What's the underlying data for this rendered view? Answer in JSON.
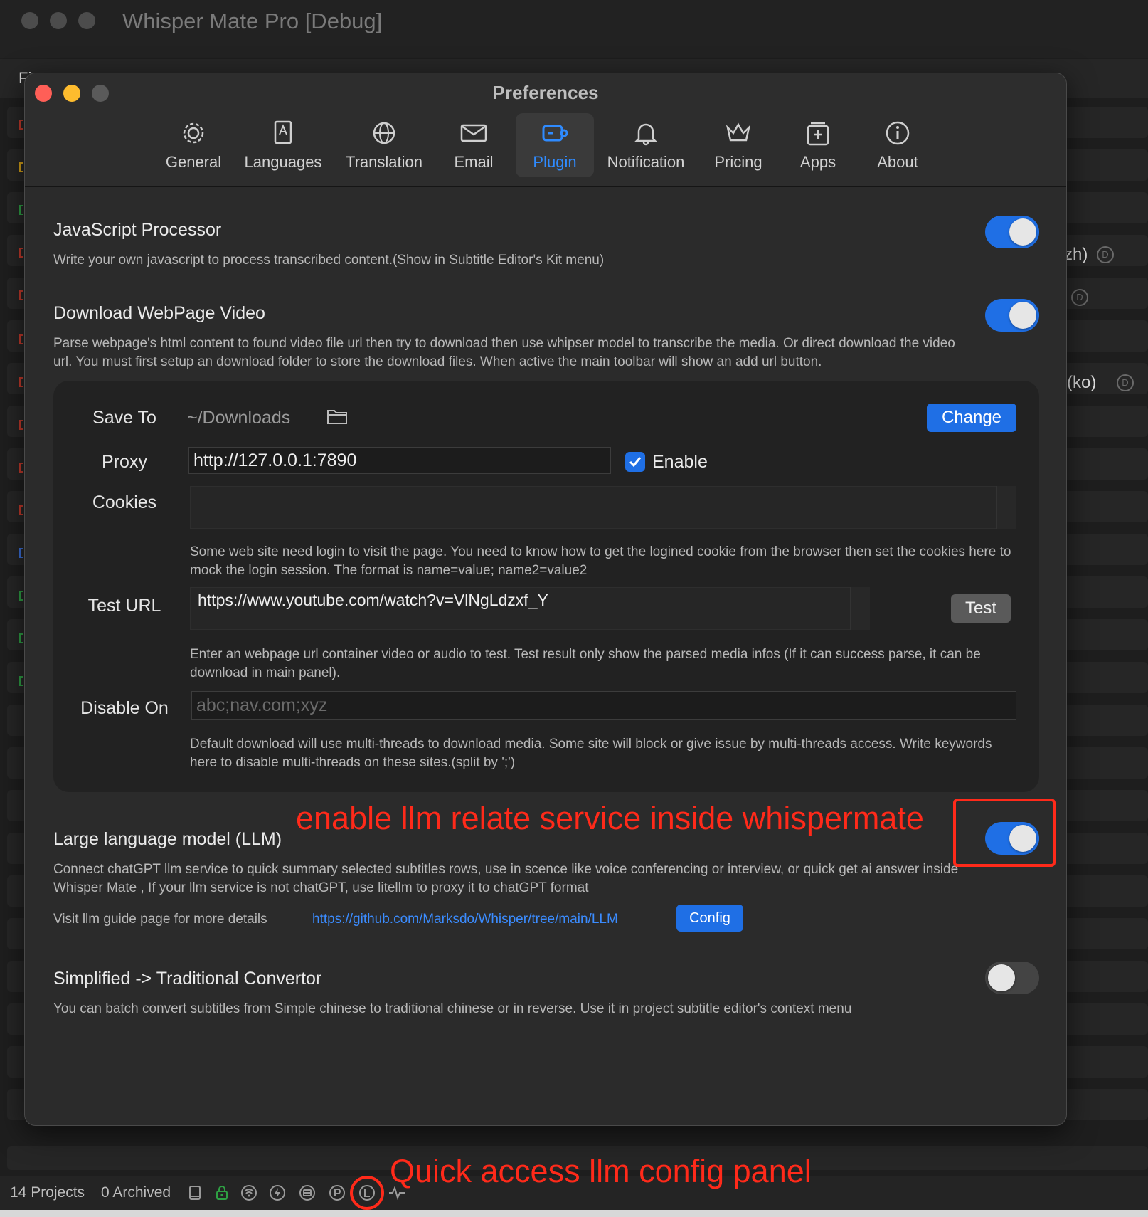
{
  "app": {
    "title": "Whisper Mate Pro [Debug]",
    "menu_first_letter": "Fi"
  },
  "background_list": {
    "visible_text_1": "zh)",
    "visible_text_2": "(ko)",
    "badge_letter": "D"
  },
  "preferences": {
    "title": "Preferences",
    "tabs": [
      {
        "label": "General",
        "icon": "gear-icon"
      },
      {
        "label": "Languages",
        "icon": "dictionary-icon"
      },
      {
        "label": "Translation",
        "icon": "globe-icon"
      },
      {
        "label": "Email",
        "icon": "envelope-icon"
      },
      {
        "label": "Plugin",
        "icon": "plugin-icon"
      },
      {
        "label": "Notification",
        "icon": "bell-icon"
      },
      {
        "label": "Pricing",
        "icon": "crown-icon"
      },
      {
        "label": "Apps",
        "icon": "apps-icon"
      },
      {
        "label": "About",
        "icon": "info-icon"
      }
    ],
    "active_tab": "Plugin"
  },
  "plugins": {
    "js_processor": {
      "title": "JavaScript Processor",
      "description": "Write your own javascript to process transcribed content.(Show in Subtitle Editor's Kit menu)",
      "enabled": true
    },
    "download_video": {
      "title": "Download WebPage Video",
      "description": "Parse webpage's html content to found video file url then try to download then use whipser model to transcribe the media. Or direct download the video url. You must first setup an download folder to store the download files. When active the main toolbar will show an add url button.",
      "enabled": true,
      "save_to_label": "Save To",
      "save_to_value": "~/Downloads",
      "change_button": "Change",
      "proxy_label": "Proxy",
      "proxy_value": "http://127.0.0.1:7890",
      "proxy_enable_label": "Enable",
      "proxy_enabled": true,
      "cookies_label": "Cookies",
      "cookies_value": "",
      "cookies_help": "Some web site need login to visit the page. You need to know how to get the logined cookie from the browser then set the cookies here to mock the login session. The format is name=value; name2=value2",
      "test_url_label": "Test URL",
      "test_url_value": "https://www.youtube.com/watch?v=VlNgLdzxf_Y",
      "test_button": "Test",
      "test_url_help": "Enter an webpage url container video or audio to test. Test result only show the parsed media infos (If it can success parse, it can be download in main panel).",
      "disable_on_label": "Disable On",
      "disable_on_placeholder": "abc;nav.com;xyz",
      "disable_on_help": "Default download will use multi-threads to download media. Some site will block or give issue by multi-threads access. Write keywords here to disable multi-threads on these sites.(split by ';')"
    },
    "llm": {
      "title": "Large language model (LLM)",
      "description": "Connect chatGPT llm service to quick summary selected subtitles rows, use in scence like voice conferencing or interview, or quick get ai answer inside Whisper Mate , If your llm service is not chatGPT, use litellm to proxy it to chatGPT format",
      "enabled": true,
      "guide_text": "Visit llm guide page for more details",
      "guide_link": "https://github.com/Marksdo/Whisper/tree/main/LLM",
      "config_button": "Config"
    },
    "convertor": {
      "title": "Simplified -> Traditional Convertor",
      "description": "You can batch convert subtitles from Simple chinese to traditional chinese or in reverse. Use it in project subtitle editor's context menu",
      "enabled": false
    }
  },
  "annotations": {
    "llm_toggle_note": "enable llm relate service inside whispermate",
    "status_note": "Quick access llm config panel"
  },
  "statusbar": {
    "projects": "14 Projects",
    "archived": "0 Archived",
    "icons": [
      "notebook-icon",
      "lock-icon",
      "wifi-icon",
      "bolt-icon",
      "storage-icon",
      "p-circle-icon",
      "llm-icon",
      "waveform-icon"
    ]
  },
  "colors": {
    "accent": "#1f6fe5",
    "annotation": "#ff2a1a",
    "traffic_red": "#ff5f57",
    "traffic_yellow": "#febc2e",
    "traffic_gray": "#5a5a5a"
  }
}
